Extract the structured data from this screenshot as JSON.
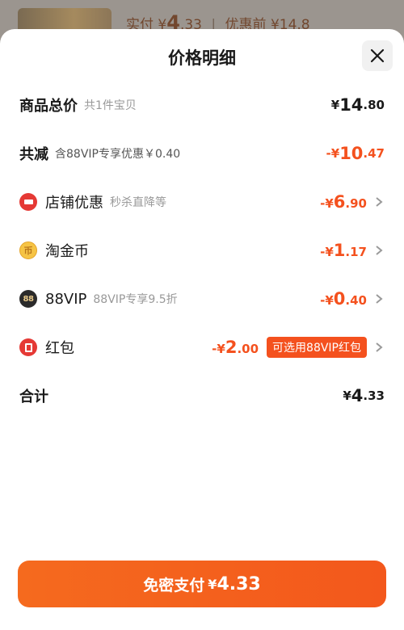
{
  "background": {
    "text_prefix": "实付",
    "currency": "¥",
    "amount_big": "4",
    "amount_dec": ".33",
    "before_label": "优惠前",
    "before_amount": "¥14.8"
  },
  "sheet": {
    "title": "价格明细",
    "close_icon": "close-icon"
  },
  "rows": {
    "subtotal": {
      "label": "商品总价",
      "sub": "共1件宝贝",
      "cur": "¥",
      "int": "14",
      "dec": ".80"
    },
    "total_discount": {
      "label": "共减",
      "sub": "含88VIP专享优惠￥0.40",
      "cur": "-¥",
      "int": "10",
      "dec": ".47"
    },
    "store": {
      "label": "店铺优惠",
      "sub": "秒杀直降等",
      "cur": "-¥",
      "int": "6",
      "dec": ".90",
      "icon": "store-discount-icon"
    },
    "coin": {
      "label": "淘金币",
      "icon_text": "币",
      "cur": "-¥",
      "int": "1",
      "dec": ".17",
      "icon": "taojinbi-coin-icon"
    },
    "vip": {
      "label": "88VIP",
      "icon_text": "88",
      "sub": "88VIP专享9.5折",
      "cur": "-¥",
      "int": "0",
      "dec": ".40",
      "icon": "88vip-icon"
    },
    "redpacket": {
      "label": "红包",
      "cur": "-¥",
      "int": "2",
      "dec": ".00",
      "badge": "可选用88VIP红包",
      "icon": "red-packet-icon"
    },
    "total": {
      "label": "合计",
      "cur": "¥",
      "int": "4",
      "dec": ".33"
    }
  },
  "pay_button": {
    "label": "免密支付",
    "cur": "¥",
    "value": "4.33"
  },
  "colors": {
    "accent": "#f4511e",
    "text": "#1a1a1a",
    "muted": "#999999"
  }
}
